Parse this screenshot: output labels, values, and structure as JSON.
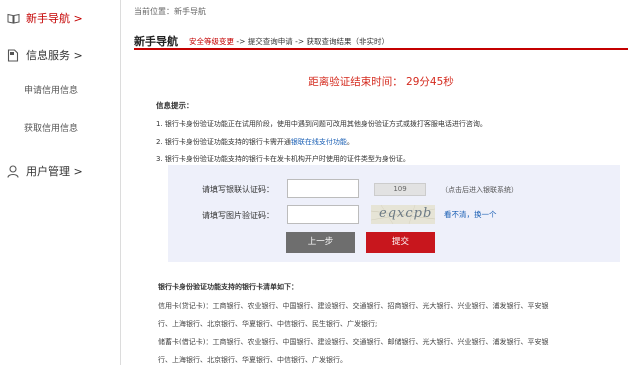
{
  "sidebar": {
    "items": [
      {
        "label": "新手导航 >",
        "icon": "book-icon"
      },
      {
        "label": "信息服务 >",
        "icon": "document-icon"
      },
      {
        "label": "用户管理 >",
        "icon": "user-icon"
      }
    ],
    "sub_items": [
      "申请信用信息",
      "获取信用信息"
    ]
  },
  "breadcrumb": "当前位置：新手导航",
  "header": {
    "title": "新手导航",
    "steps": {
      "current": "安全等级变更",
      "rest": " -> 提交查询申请 -> 获取查询结果（非实时）"
    }
  },
  "countdown": "距离验证结束时间： 29分45秒",
  "tips": {
    "title": "信息提示：",
    "line1": "1. 银行卡身份验证功能正在试用阶段，使用中遇到问题可改用其他身份验证方式或拨打客服电话进行咨询。",
    "line2_prefix": "2. 银行卡身份验证功能支持的银行卡需开通",
    "line2_link": "银联在线支付功能",
    "line2_suffix": "。",
    "line3": "3. 银行卡身份验证功能支持的银行卡在发卡机构开户时使用的证件类型为身份证。"
  },
  "form": {
    "unionpay_label": "请填写银联认证码：",
    "unionpay_value": "",
    "bank_button": "109",
    "bank_hint": "（点击后进入银联系统）",
    "captcha_label": "请填写图片验证码：",
    "captcha_value": "",
    "captcha_text": "eqxcpb",
    "refresh_link": "看不清，换一个",
    "prev_button": "上一步",
    "submit_button": "提交"
  },
  "banks": {
    "title": "银行卡身份验证功能支持的银行卡清单如下：",
    "credit_line1": "信用卡(贷记卡)：工商银行、农业银行、中国银行、建设银行、交通银行、招商银行、光大银行、兴业银行、浦发银行、平安银",
    "credit_line2": "行、上海银行、北京银行、华夏银行、中信银行、民生银行、广发银行;",
    "debit_line1": "储蓄卡(借记卡)：工商银行、农业银行、中国银行、建设银行、交通银行、邮储银行、光大银行、兴业银行、浦发银行、平安银",
    "debit_line2": "行、上海银行、北京银行、华夏银行、中信银行、广发银行。"
  },
  "colors": {
    "accent": "#c40000",
    "countdown": "#d42a1e",
    "link": "#1a5fb4",
    "form_bg": "#eef0fa"
  }
}
